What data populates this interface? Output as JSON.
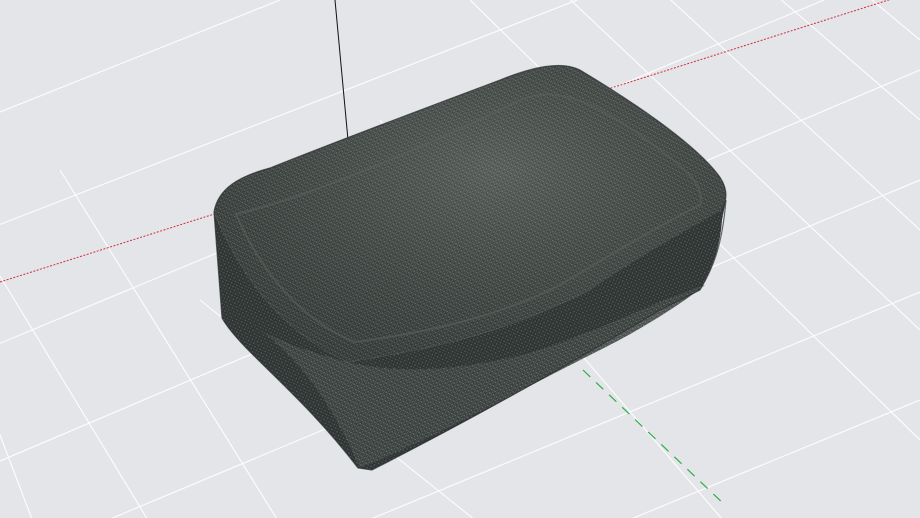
{
  "viewport": {
    "background_color": "#e4e5e9",
    "grid_color": "#ffffff",
    "axis_x_color": "#d0303c",
    "axis_y_color": "#2fae48",
    "axis_z_color": "#111111",
    "model_base_color": "#3b4040",
    "model_highlight_color": "#6c7570",
    "model_weave_colors": [
      "#8a8f6e",
      "#5d7a86",
      "#b7b28a"
    ]
  },
  "scene": {
    "object_name": "",
    "grid_visible": true,
    "axes_visible": true
  }
}
